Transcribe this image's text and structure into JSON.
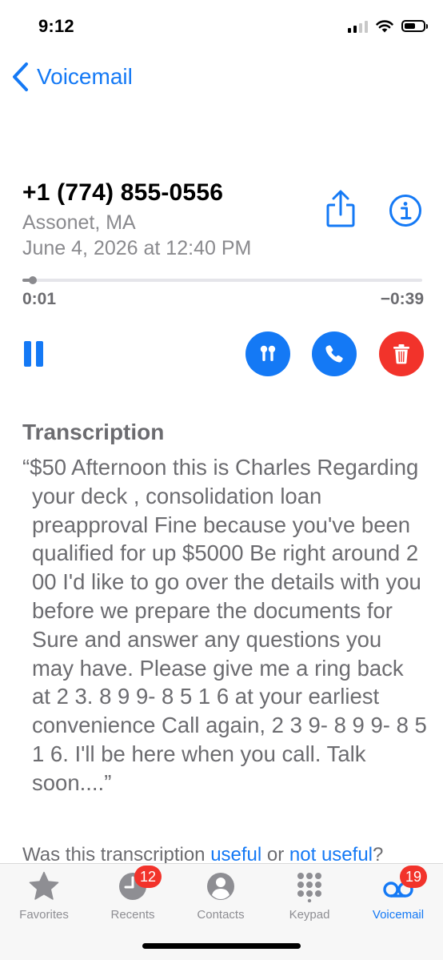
{
  "status_bar": {
    "time": "9:12"
  },
  "nav": {
    "back_label": "Voicemail"
  },
  "voicemail": {
    "phone_number": "+1 (774) 855-0556",
    "location": "Assonet, MA",
    "datetime": "June 4, 2026 at 12:40 PM",
    "elapsed": "0:01",
    "remaining": "−0:39",
    "progress_fraction": 0.025
  },
  "controls": {
    "play_state": "paused-icon",
    "audio_route_icon": "airpods-icon",
    "call_icon": "phone-icon",
    "delete_icon": "trash-icon"
  },
  "transcription": {
    "heading": "Transcription",
    "text": "“$50 Afternoon this is Charles Regarding your deck , consolidation loan preapproval Fine because you've been qualified for up $5000 Be right around 2 00 I'd like to go over the details with you before we prepare the documents for Sure and answer any questions you may have. Please give me a ring back at 2 3. 8 9 9- 8 5 1 6 at your earliest convenience Call again, 2 3 9- 8 9 9- 8 5 1 6. I'll be here when you call. Talk soon....”",
    "feedback_prefix": "Was this transcription ",
    "feedback_useful": "useful",
    "feedback_or": " or ",
    "feedback_not_useful": "not useful",
    "feedback_suffix": "?"
  },
  "tabs": [
    {
      "label": "Favorites",
      "icon": "star-icon"
    },
    {
      "label": "Recents",
      "icon": "clock-icon",
      "badge": "12"
    },
    {
      "label": "Contacts",
      "icon": "person-icon"
    },
    {
      "label": "Keypad",
      "icon": "keypad-icon"
    },
    {
      "label": "Voicemail",
      "icon": "voicemail-icon",
      "badge": "19",
      "active": true
    }
  ],
  "colors": {
    "accent": "#1479f5",
    "destructive": "#f2332b",
    "secondary_text": "#8a8a8e"
  }
}
